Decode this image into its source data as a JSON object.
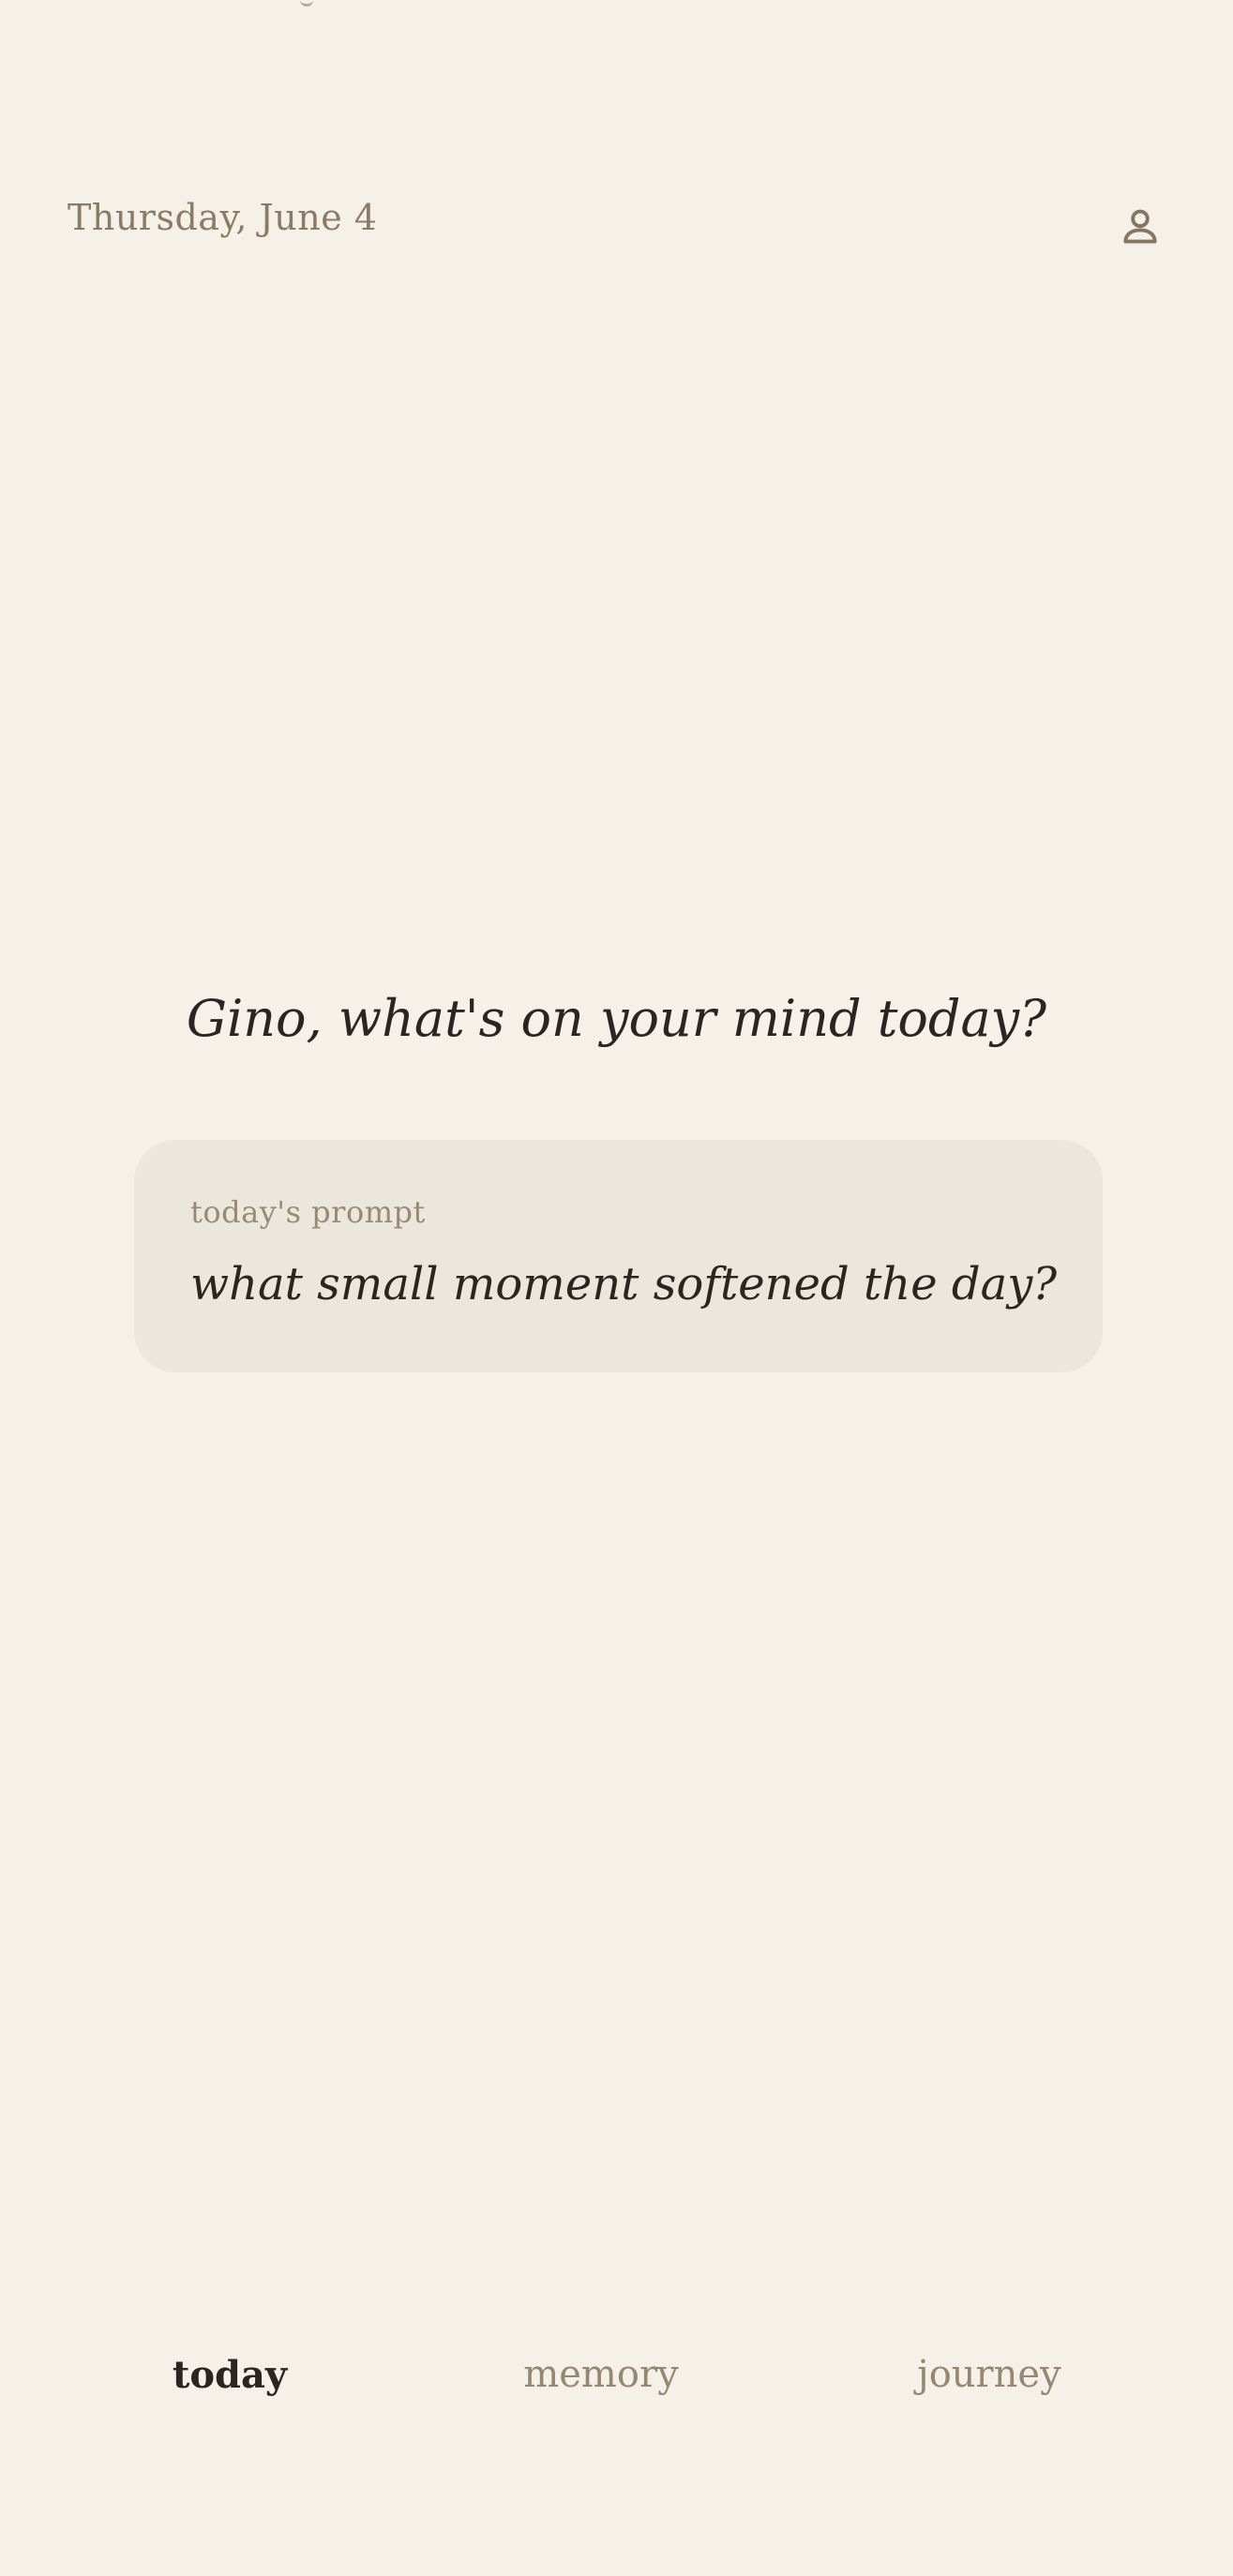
{
  "header": {
    "date": "Thursday, June 4",
    "profile_icon": "person-icon"
  },
  "main": {
    "greeting": "Gino, what's on your mind today?",
    "prompt_card": {
      "label": "today's prompt",
      "text": "what small moment softened the day?"
    }
  },
  "nav": {
    "items": [
      {
        "label": "today",
        "active": true
      },
      {
        "label": "memory",
        "active": false
      },
      {
        "label": "journey",
        "active": false
      }
    ]
  },
  "colors": {
    "background": "#f5f0e8",
    "card": "#ece7dd",
    "text_primary": "#2a2520",
    "text_muted": "#8c7b63"
  }
}
